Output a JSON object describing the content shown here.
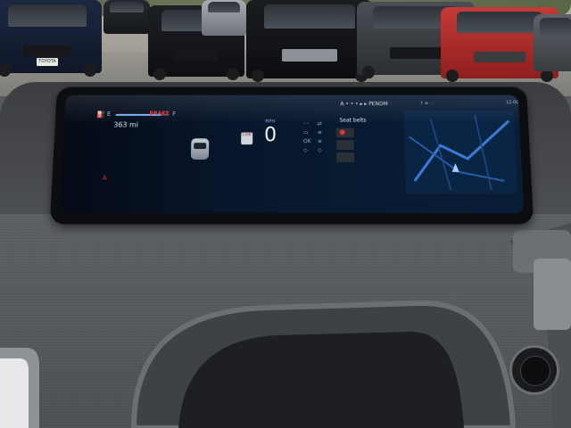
{
  "scene": {
    "plate_text": "TOYOTA"
  },
  "display": {
    "fuel_empty": "E",
    "fuel_full": "F",
    "fuel_level": 0.85,
    "brake_warning": "BRAKE",
    "range": "363 mi",
    "gear_badge": "CHK",
    "speed_unit": "MPH",
    "speed": "0",
    "warning_letter": "A",
    "seatbelt_label": "Seat belts",
    "status_icons": [
      "◦◦",
      "⇄",
      "▭",
      "≡",
      "OK",
      "≡",
      "◇",
      "◇"
    ],
    "nav_header": "A • • • ▸ ▸  PENDM",
    "nav_icons": "↑    ≡    ◦",
    "nav_time": "12:00"
  },
  "colors": {
    "warning_red": "#e0373a",
    "accent_blue": "#7fb3ff",
    "map_road": "#3d7bd6"
  },
  "icons": [
    "fuel-pump-icon",
    "car-icon",
    "seatbelt-icon",
    "map-icon"
  ]
}
